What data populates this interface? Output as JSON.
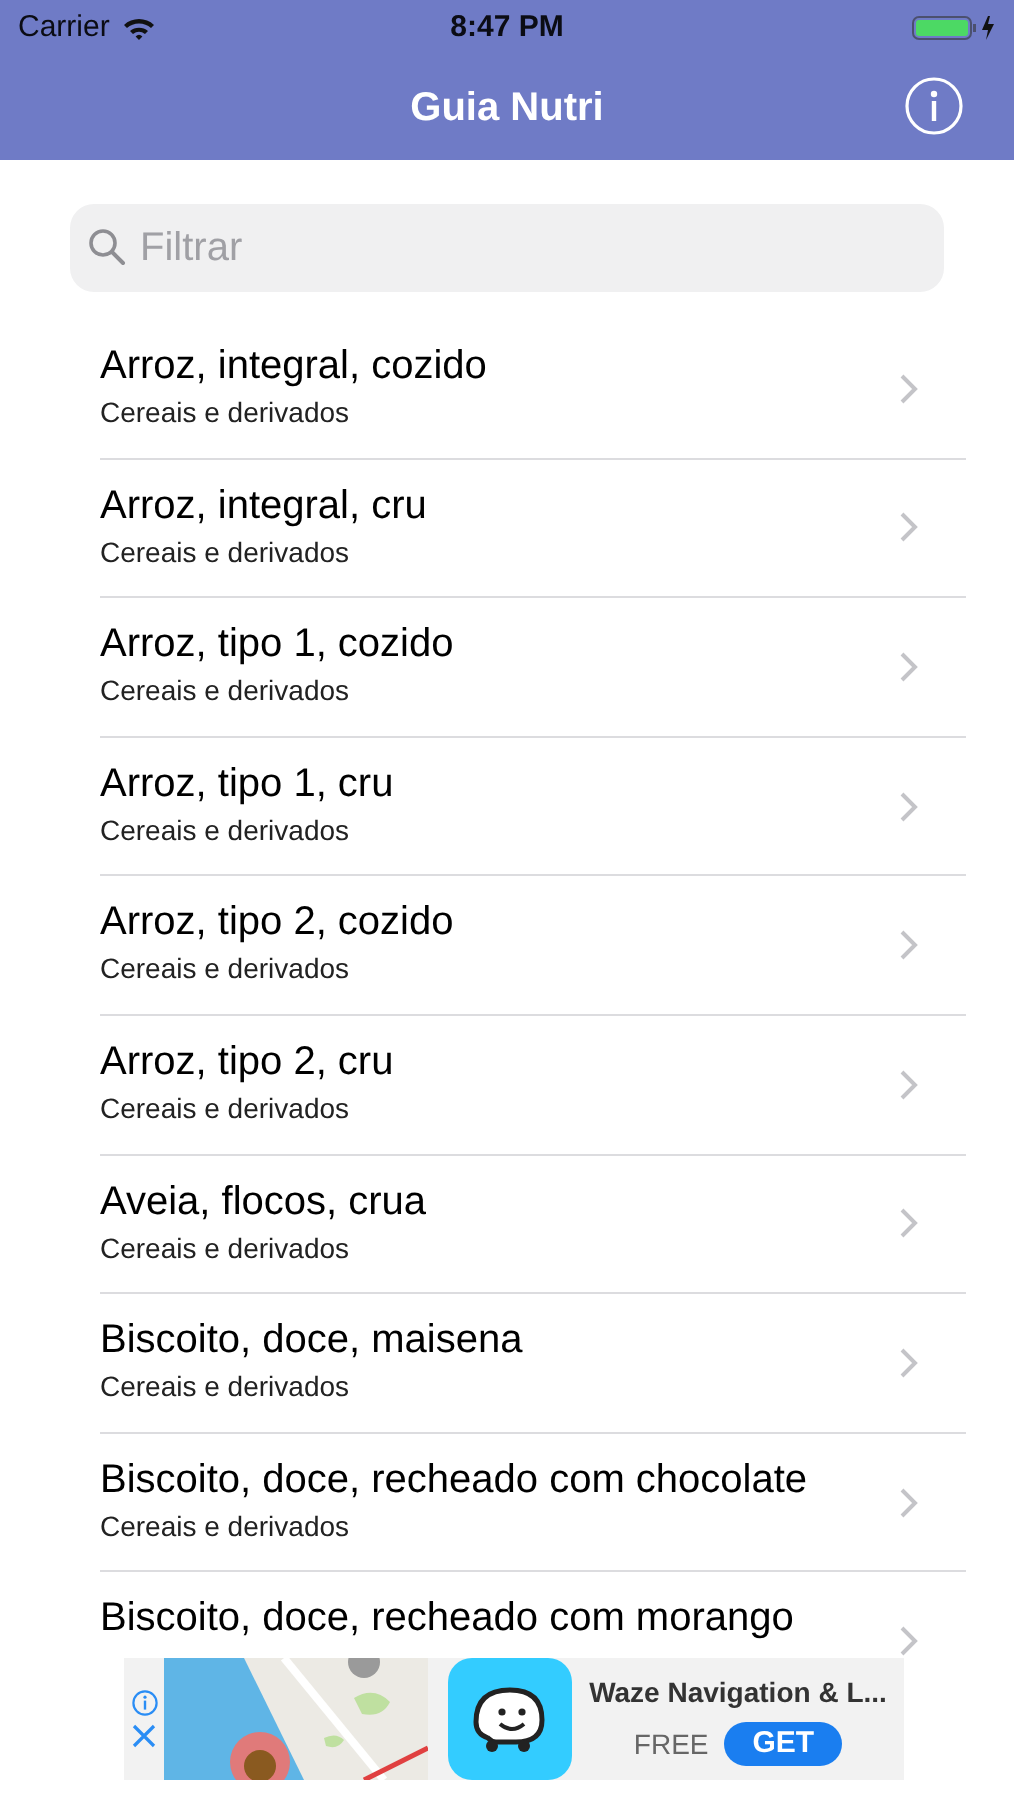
{
  "status_bar": {
    "carrier": "Carrier",
    "time": "8:47 PM"
  },
  "nav_bar": {
    "title": "Guia Nutri"
  },
  "search": {
    "placeholder": "Filtrar"
  },
  "rows": [
    {
      "title": "Arroz, integral, cozido",
      "subtitle": "Cereais e derivados"
    },
    {
      "title": "Arroz, integral, cru",
      "subtitle": "Cereais e derivados"
    },
    {
      "title": "Arroz, tipo 1, cozido",
      "subtitle": "Cereais e derivados"
    },
    {
      "title": "Arroz, tipo 1, cru",
      "subtitle": "Cereais e derivados"
    },
    {
      "title": "Arroz, tipo 2, cozido",
      "subtitle": "Cereais e derivados"
    },
    {
      "title": "Arroz, tipo 2, cru",
      "subtitle": "Cereais e derivados"
    },
    {
      "title": "Aveia, flocos, crua",
      "subtitle": "Cereais e derivados"
    },
    {
      "title": "Biscoito, doce, maisena",
      "subtitle": "Cereais e derivados"
    },
    {
      "title": "Biscoito, doce, recheado com chocolate",
      "subtitle": "Cereais e derivados"
    },
    {
      "title": "Biscoito, doce, recheado com morango"
    }
  ],
  "ad": {
    "app_name": "Waze Navigation & L...",
    "price": "FREE",
    "button": "GET"
  }
}
